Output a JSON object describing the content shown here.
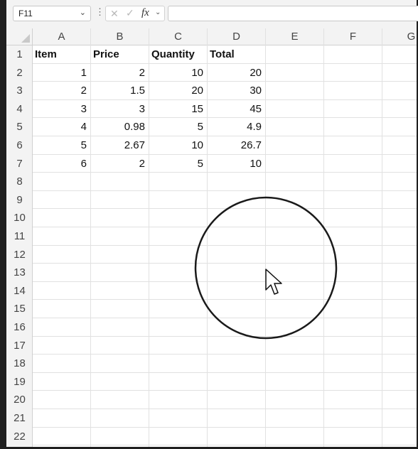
{
  "formula_bar": {
    "name_box": "F11",
    "formula": ""
  },
  "columns": [
    "A",
    "B",
    "C",
    "D",
    "E",
    "F",
    "G"
  ],
  "rows": [
    "1",
    "2",
    "3",
    "4",
    "5",
    "6",
    "7",
    "8",
    "9",
    "10",
    "11",
    "12",
    "13",
    "14",
    "15",
    "16",
    "17",
    "18",
    "19",
    "20",
    "21",
    "22"
  ],
  "headers": [
    "Item",
    "Price",
    "Quantity",
    "Total"
  ],
  "data": [
    [
      "1",
      "2",
      "10",
      "20"
    ],
    [
      "2",
      "1.5",
      "20",
      "30"
    ],
    [
      "3",
      "3",
      "15",
      "45"
    ],
    [
      "4",
      "0.98",
      "5",
      "4.9"
    ],
    [
      "5",
      "2.67",
      "10",
      "26.7"
    ],
    [
      "6",
      "2",
      "5",
      "10"
    ]
  ],
  "icons": {
    "cancel": "close-icon",
    "enter": "check-icon",
    "function": "fx-icon",
    "cursor": "mouse-pointer-icon"
  }
}
